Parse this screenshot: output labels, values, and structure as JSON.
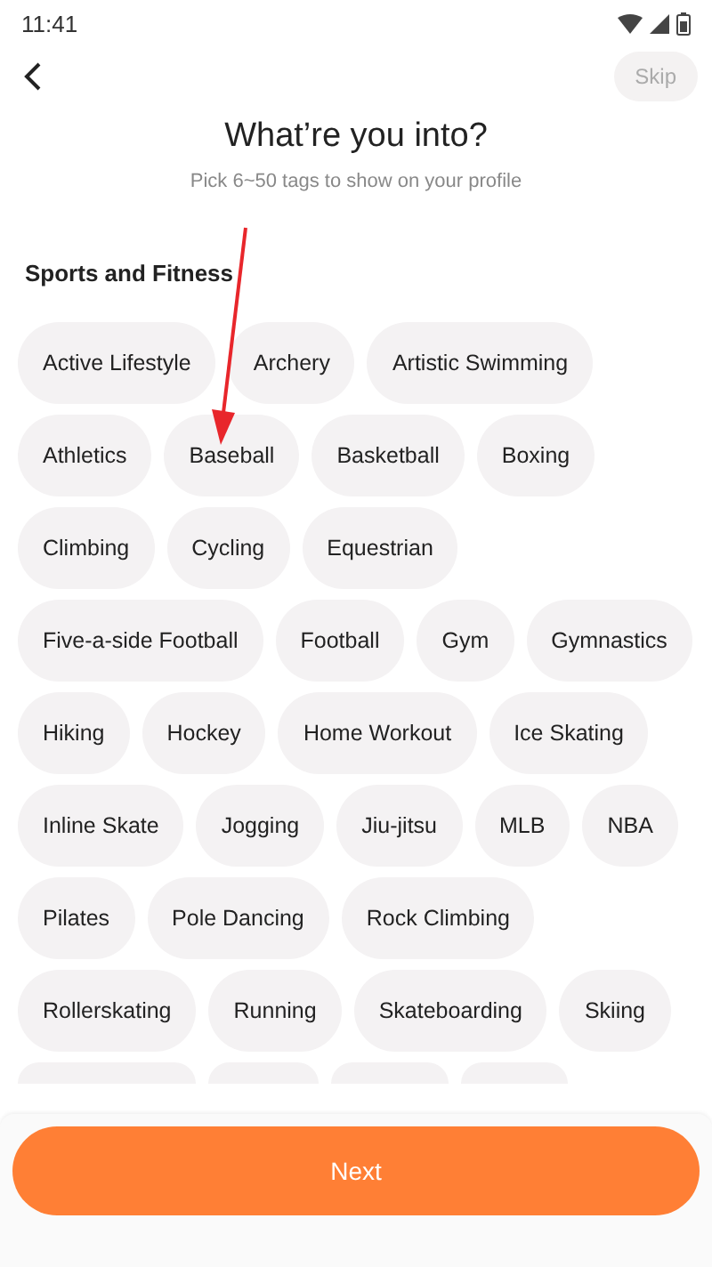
{
  "status_bar": {
    "time": "11:41"
  },
  "header": {
    "skip_label": "Skip"
  },
  "title": "What’re you into?",
  "subtitle": "Pick 6~50 tags to show on your profile",
  "section": {
    "title": "Sports and Fitness",
    "tags": [
      {
        "label": "Active Lifestyle",
        "selected": false
      },
      {
        "label": "Archery",
        "selected": false
      },
      {
        "label": "Artistic Swimming",
        "selected": false
      },
      {
        "label": "Athletics",
        "selected": false
      },
      {
        "label": "Baseball",
        "selected": false
      },
      {
        "label": "Basketball",
        "selected": false
      },
      {
        "label": "Boxing",
        "selected": false
      },
      {
        "label": "Climbing",
        "selected": false
      },
      {
        "label": "Cycling",
        "selected": false
      },
      {
        "label": "Equestrian",
        "selected": false
      },
      {
        "label": "Five-a-side Football",
        "selected": false
      },
      {
        "label": "Football",
        "selected": false
      },
      {
        "label": "Gym",
        "selected": false
      },
      {
        "label": "Gymnastics",
        "selected": false
      },
      {
        "label": "Hiking",
        "selected": false
      },
      {
        "label": "Hockey",
        "selected": false
      },
      {
        "label": "Home Workout",
        "selected": false
      },
      {
        "label": "Ice Skating",
        "selected": false
      },
      {
        "label": "Inline Skate",
        "selected": false
      },
      {
        "label": "Jogging",
        "selected": false
      },
      {
        "label": "Jiu-jitsu",
        "selected": false
      },
      {
        "label": "MLB",
        "selected": false
      },
      {
        "label": "NBA",
        "selected": false
      },
      {
        "label": "Pilates",
        "selected": false
      },
      {
        "label": "Pole Dancing",
        "selected": false
      },
      {
        "label": "Rock Climbing",
        "selected": false
      },
      {
        "label": "Rollerskating",
        "selected": false
      },
      {
        "label": "Running",
        "selected": false
      },
      {
        "label": "Skateboarding",
        "selected": false
      },
      {
        "label": "Skiing",
        "selected": false
      }
    ]
  },
  "next_button": {
    "label": "Next"
  }
}
